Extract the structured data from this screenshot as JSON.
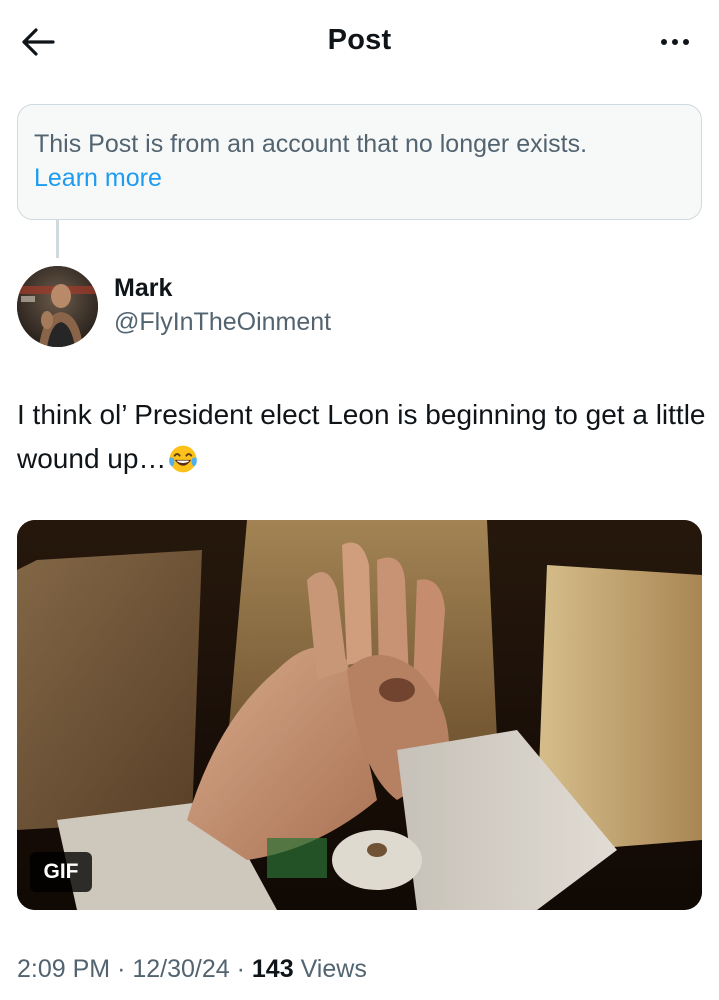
{
  "header": {
    "title": "Post",
    "back_icon": "arrow-left-icon",
    "more_icon": "more-horizontal-icon"
  },
  "notice": {
    "text": "This Post is from an account that no longer exists.",
    "link_label": "Learn more"
  },
  "author": {
    "name": "Mark",
    "handle": "@FlyInTheOinment"
  },
  "post": {
    "text": "I think ol’ President elect Leon is beginning to get a little wound up…",
    "emoji": "face-with-tears-of-joy"
  },
  "media": {
    "badge": "GIF"
  },
  "meta": {
    "time": "2:09 PM",
    "date": "12/30/24",
    "separator": "·",
    "views_count": "143",
    "views_label": "Views"
  },
  "colors": {
    "text_primary": "#0f1419",
    "text_secondary": "#536471",
    "link": "#1d9bf0",
    "notice_bg": "#f7f9f9",
    "border": "#cfd9de"
  }
}
